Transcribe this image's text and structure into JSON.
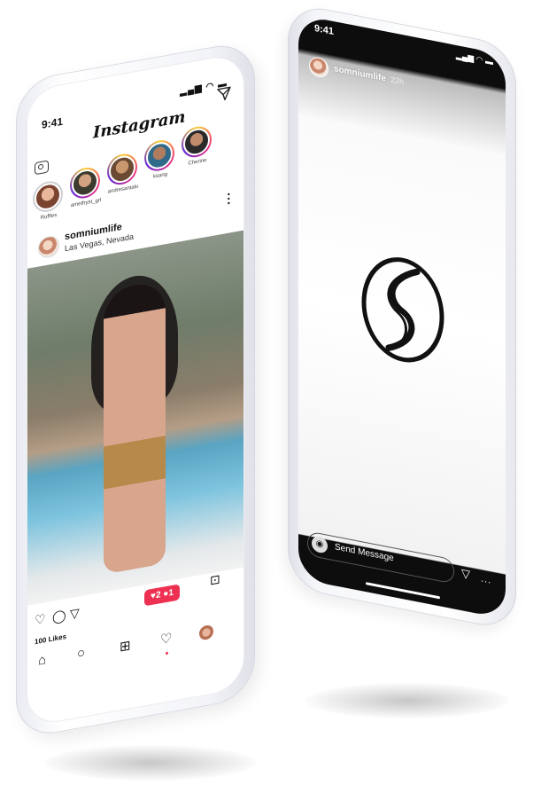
{
  "left_phone": {
    "status": {
      "time": "9:41",
      "icons": "▂▄▆ ◠ ▬"
    },
    "header": {
      "logo": "Instagram",
      "dm_icon": "paper-plane-icon"
    },
    "stories": [
      {
        "name": "Ruffles",
        "seen": true
      },
      {
        "name": "amethyst_grl",
        "seen": false
      },
      {
        "name": "andresantalo",
        "seen": false
      },
      {
        "name": "ksang",
        "seen": false
      },
      {
        "name": "Cherine",
        "seen": false
      }
    ],
    "post": {
      "username": "somniumlife",
      "location": "Las Vegas, Nevada",
      "likes_bubble": "♥2 ●1",
      "likes_text": "100 Likes"
    },
    "actions": {
      "like": "♡",
      "comment": "◯",
      "share": "▽",
      "save": "⊡"
    },
    "tabbar": {
      "home": "⌂",
      "search": "○",
      "add": "⊞",
      "activity": "♡"
    }
  },
  "right_phone": {
    "status": {
      "time": "9:41",
      "icons": "▂▄▆ ◠ ▬"
    },
    "story": {
      "username": "somniumlife",
      "ago": "22h"
    },
    "reply": {
      "placeholder": "Send Message",
      "send": "▽",
      "more": "..."
    }
  },
  "colors": {
    "accent": "#ee3153",
    "story_ring": "#ee2a7b"
  }
}
